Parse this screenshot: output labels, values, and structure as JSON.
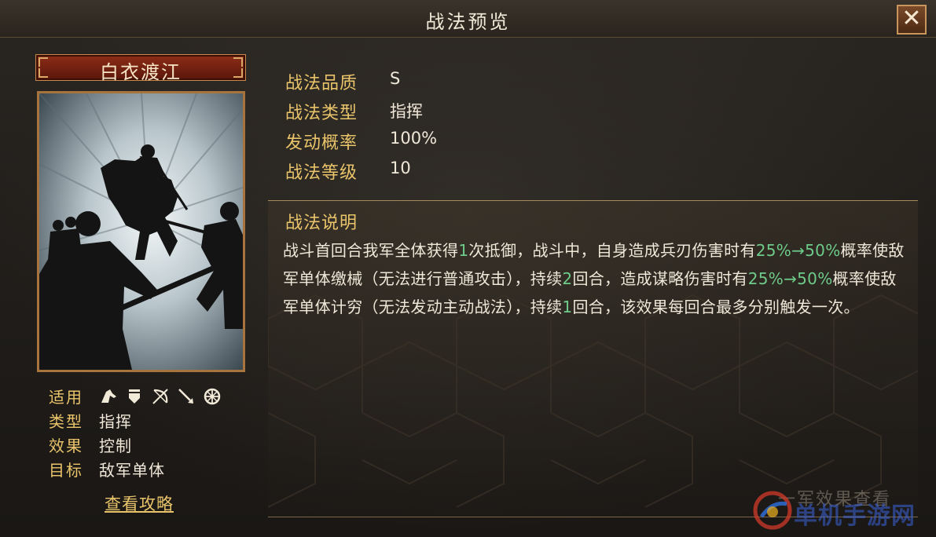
{
  "window": {
    "title": "战法预览",
    "close_label": "✕"
  },
  "skill": {
    "name": "白衣渡江",
    "properties": [
      {
        "label": "战法品质",
        "value": "S"
      },
      {
        "label": "战法类型",
        "value": "指挥"
      },
      {
        "label": "发动概率",
        "value": "100%"
      },
      {
        "label": "战法等级",
        "value": "10"
      }
    ],
    "description_title": "战法说明",
    "description_parts": [
      {
        "text": "战斗首回合我军全体获得",
        "hl": false
      },
      {
        "text": "1",
        "hl": true
      },
      {
        "text": "次抵御，战斗中，自身造成兵刃伤害时有",
        "hl": false
      },
      {
        "text": "25%→50%",
        "hl": true
      },
      {
        "text": "概率使敌军单体缴械（无法进行普通攻击），持续",
        "hl": false
      },
      {
        "text": "2",
        "hl": true
      },
      {
        "text": "回合，造成谋略伤害时有",
        "hl": false
      },
      {
        "text": "25%→50%",
        "hl": true
      },
      {
        "text": "概率使敌军单体计穷（无法发动主动战法），持续",
        "hl": false
      },
      {
        "text": "1",
        "hl": true
      },
      {
        "text": "回合，该效果每回合最多分别触发一次。",
        "hl": false
      }
    ]
  },
  "meta": {
    "applicable_label": "适用",
    "troop_icons": [
      "cavalry-icon",
      "shield-icon",
      "bow-icon",
      "spear-icon",
      "siege-icon"
    ],
    "type_label": "类型",
    "type_value": "指挥",
    "effect_label": "效果",
    "effect_value": "控制",
    "target_label": "目标",
    "target_value": "敌军单体"
  },
  "guide_link": "查看攻略",
  "watermark_text": "一军效果查看",
  "logo_text": "单机手游网",
  "colors": {
    "gold_label": "#e9c46a",
    "highlight_green": "#6ecb8a",
    "text": "#efe7d8"
  }
}
